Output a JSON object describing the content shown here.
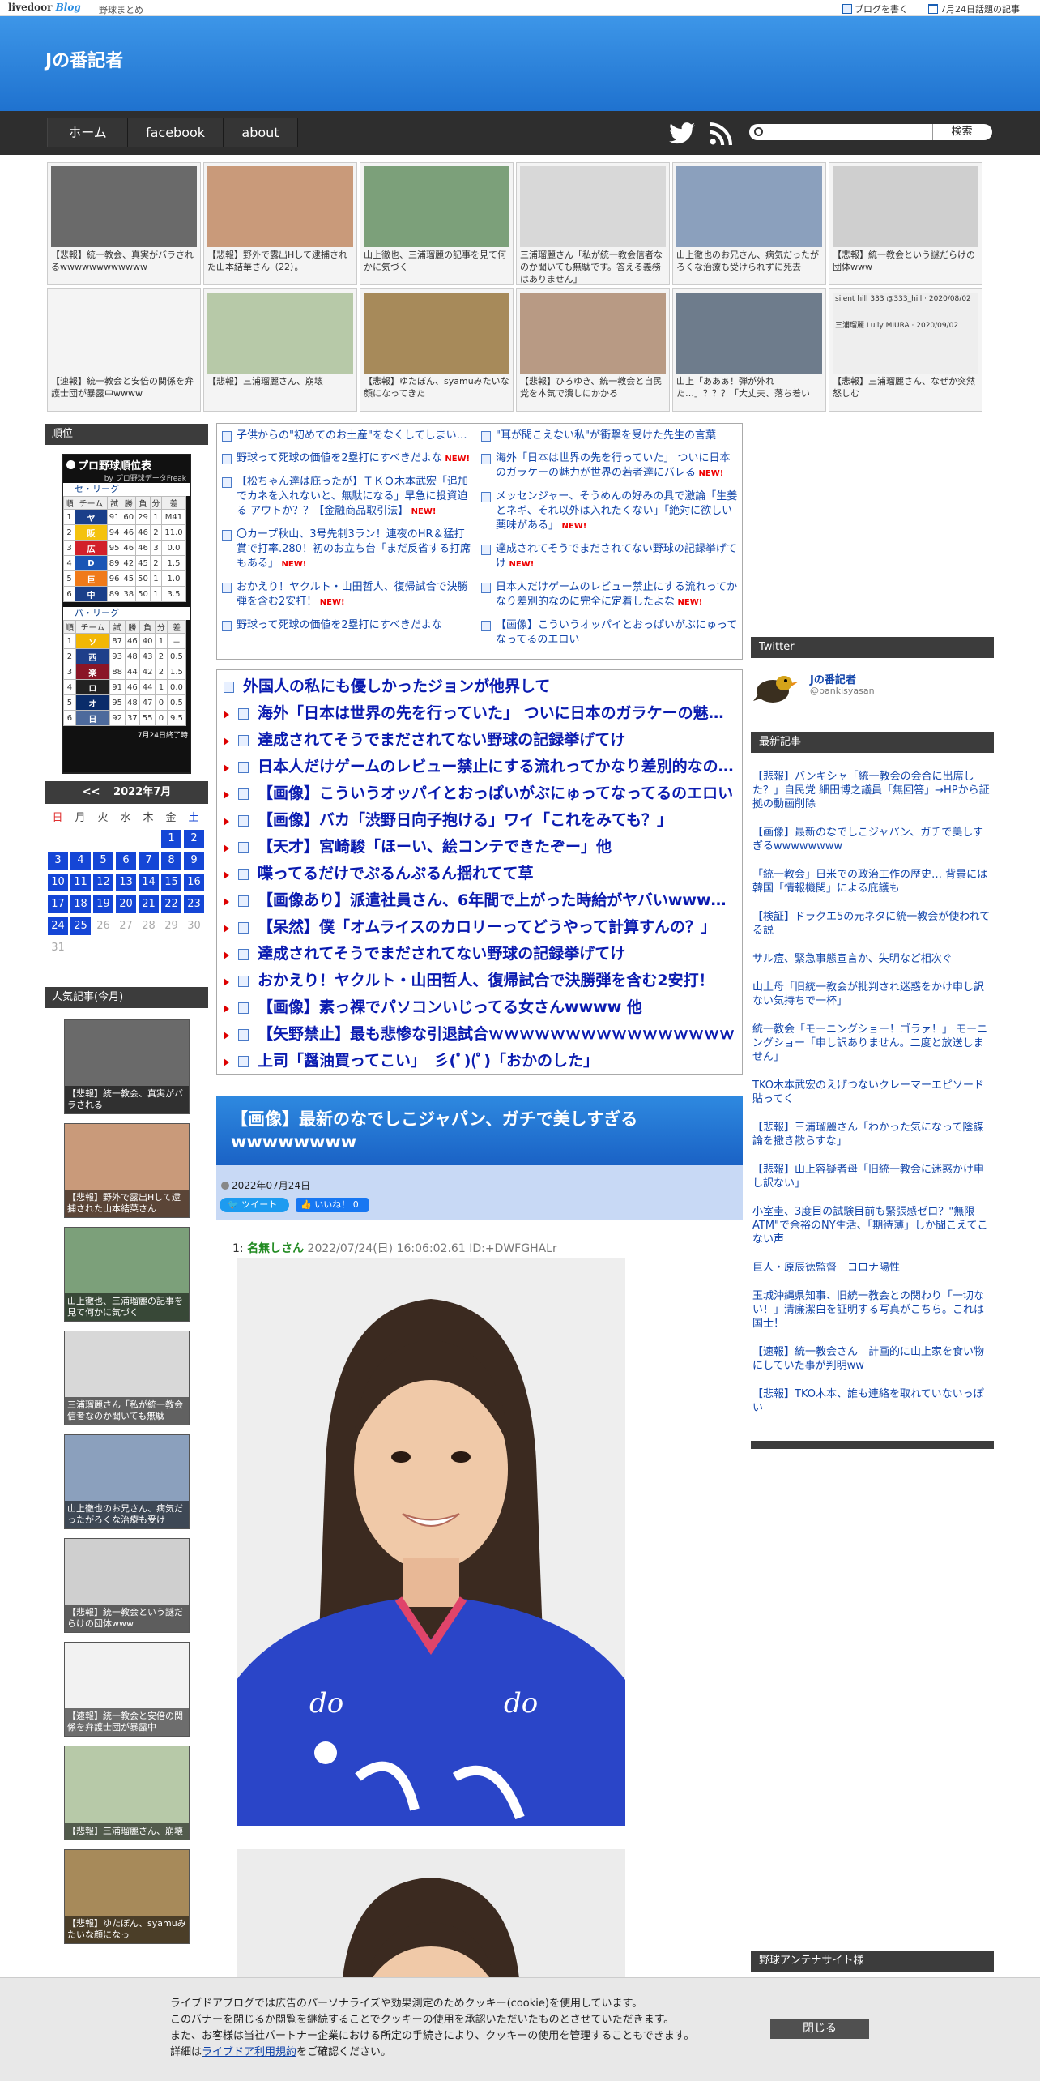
{
  "topbar": {
    "logo_main": "livedoor",
    "logo_sub": "Blog",
    "blog_name_small": "野球まとめ",
    "write_blog": "ブログを書く",
    "trending": "7月24日話題の記事"
  },
  "header": {
    "title": "Jの番記者"
  },
  "nav": {
    "items": [
      "ホーム",
      "facebook",
      "about"
    ],
    "search_button": "検索"
  },
  "thumbs": [
    {
      "caption": "【悲報】統一教会、真実がバラされるwwwwwwwwwwww",
      "color": "#6a6a6a"
    },
    {
      "caption": "【悲報】野外で露出Hして逮捕された山本結華さん（22）。",
      "color": "#c99a7a"
    },
    {
      "caption": "山上徹也、三浦瑠麗の記事を見て何かに気づく",
      "color": "#7ca07a"
    },
    {
      "caption": "三浦瑠麗さん「私が統一教会信者なのか聞いても無駄です。答える義務はありません」",
      "color": "#d8d8d8"
    },
    {
      "caption": "山上徹也のお兄さん、病気だったがろくな治療も受けられずに死去",
      "color": "#8ba0bd"
    },
    {
      "caption": "【悲報】統一教会という謎だらけの団体www",
      "color": "#cfcfcf"
    },
    {
      "caption": "【速報】統一教会と安倍の関係を弁護士団が暴露中wwww",
      "color": "#f4f4f4"
    },
    {
      "caption": "【悲報】三浦瑠麗さん、崩壊",
      "color": "#b7c9a8"
    },
    {
      "caption": "【悲報】ゆたぼん、syamuみたいな顔になってきた",
      "color": "#a78a5a"
    },
    {
      "caption": "【悲報】ひろゆき、統一教会と自民党を本気で潰しにかかる",
      "color": "#b89a84"
    },
    {
      "caption": "山上「ああぁ！弾が外れた…」？？？「大丈夫、落ち着い",
      "color": "#6e7c8c"
    },
    {
      "caption": "【悲報】三浦瑠麗さん、なぜか突然怒しむ",
      "color": "#eeeeee"
    }
  ],
  "thumb_tweet": {
    "user": "silent hill 333",
    "handle": "@333_hill",
    "date": "2020/08/02",
    "name2": "三浦瑠麗 Lully MIURA",
    "date2": "2020/09/02"
  },
  "sidebar": {
    "ranking_header": "順位",
    "standings_title": "プロ野球順位表",
    "standings_sub": "by プロ野球データFreak",
    "central_label": "セ・リーグ",
    "pacific_label": "パ・リーグ",
    "cols": [
      "順",
      "チーム",
      "試",
      "勝",
      "負",
      "分",
      "差"
    ],
    "central": [
      [
        "1",
        "ヤ",
        "91",
        "60",
        "29",
        "1",
        "M41"
      ],
      [
        "2",
        "阪",
        "94",
        "46",
        "46",
        "2",
        "11.0"
      ],
      [
        "3",
        "広",
        "95",
        "46",
        "46",
        "3",
        "0.0"
      ],
      [
        "4",
        "D",
        "89",
        "42",
        "45",
        "2",
        "1.5"
      ],
      [
        "5",
        "巨",
        "96",
        "45",
        "50",
        "1",
        "1.0"
      ],
      [
        "6",
        "中",
        "89",
        "38",
        "50",
        "1",
        "3.5"
      ]
    ],
    "pacific": [
      [
        "1",
        "ソ",
        "87",
        "46",
        "40",
        "1",
        "－"
      ],
      [
        "2",
        "西",
        "93",
        "48",
        "43",
        "2",
        "0.5"
      ],
      [
        "3",
        "楽",
        "88",
        "44",
        "42",
        "2",
        "1.5"
      ],
      [
        "4",
        "ロ",
        "91",
        "46",
        "44",
        "1",
        "0.0"
      ],
      [
        "5",
        "オ",
        "95",
        "48",
        "47",
        "0",
        "0.5"
      ],
      [
        "6",
        "日",
        "92",
        "37",
        "55",
        "0",
        "9.5"
      ]
    ],
    "standings_footer": "7月24日終了時",
    "cal_prev": "<<",
    "cal_title": "2022年7月",
    "dows": [
      "日",
      "月",
      "火",
      "水",
      "木",
      "金",
      "土"
    ],
    "popular_header": "人気記事(今月)",
    "popular": [
      {
        "caption": "【悲報】統一教会、真実がバラされる",
        "color": "#6a6a6a"
      },
      {
        "caption": "【悲報】野外で露出Hして逮捕された山本結菜さん",
        "color": "#c99a7a"
      },
      {
        "caption": "山上徹也、三浦瑠麗の記事を見て何かに気づく",
        "color": "#7ca07a"
      },
      {
        "caption": "三浦瑠麗さん「私が統一教会信者なのか聞いても無駄",
        "color": "#d8d8d8"
      },
      {
        "caption": "山上徹也のお兄さん、病気だったがろくな治療も受け",
        "color": "#8ba0bd"
      },
      {
        "caption": "【悲報】統一教会という謎だらけの団体www",
        "color": "#cfcfcf"
      },
      {
        "caption": "【速報】統一教会と安倍の関係を弁護士団が暴露中",
        "color": "#f2f2f2"
      },
      {
        "caption": "【悲報】三浦瑠麗さん、崩壊",
        "color": "#b7c9a8"
      },
      {
        "caption": "【悲報】ゆたぼん、syamuみたいな顔になっ",
        "color": "#a78a5a"
      }
    ]
  },
  "list_left": [
    {
      "text": "子供からの\"初めてのお土産\"をなくしてしまい…",
      "new": false
    },
    {
      "text": "野球って死球の価値を2塁打にすべきだよな",
      "new": true
    },
    {
      "text": "【松ちゃん達は庇ったが】ＴＫＯ木本武宏「追加でカネを入れないと、無駄になる」早急に投資迫る アウトか？？【金融商品取引法】",
      "new": true
    },
    {
      "text": "〇カープ秋山、3号先制3ラン！連夜のHR＆猛打賞で打率.280！初のお立ち台「まだ反省する打席もある」",
      "new": true
    },
    {
      "text": "おかえり！ヤクルト・山田哲人、復帰試合で決勝弾を含む2安打！",
      "new": true
    },
    {
      "text": "野球って死球の価値を2塁打にすべきだよな",
      "new": false
    }
  ],
  "list_right": [
    {
      "text": "\"耳が聞こえない私\"が衝撃を受けた先生の言葉",
      "new": false
    },
    {
      "text": "海外「日本は世界の先を行っていた」 ついに日本のガラケーの魅力が世界の若者達にバレる",
      "new": true
    },
    {
      "text": "メッセンジャー、そうめんの好みの具で激論「生姜とネギ、それ以外は入れたくない」「絶対に欲しい薬味がある」",
      "new": true
    },
    {
      "text": "達成されてそうでまだされてない野球の記録挙げてけ",
      "new": true
    },
    {
      "text": "日本人だけゲームのレビュー禁止にする流れってかなり差別的なのに完全に定着したよな",
      "new": true
    },
    {
      "text": "【画像】こういうオッパイとおっぱいがぶにゅってなってるのエロい",
      "new": false
    }
  ],
  "big_list": [
    "外国人の私にも優しかったジョンが他界して",
    "海外「日本は世界の先を行っていた」 ついに日本のガラケーの魅力が世界の若者達にバレる",
    "達成されてそうでまだされてない野球の記録挙げてけ",
    "日本人だけゲームのレビュー禁止にする流れってかなり差別的なのに完全に定着したよな",
    "【画像】こういうオッパイとおっぱいがぶにゅってなってるのエロい",
    "【画像】バカ「渋野日向子抱ける」ワイ「これをみても？」",
    "【天才】宮崎駿「ほーい、絵コンテできたぞー」他",
    "喋ってるだけでぷるんぷるん揺れてて草",
    "【画像あり】派遣社員さん、6年間で上がった時給がヤバいwwwwwwwww",
    "【呆然】僕「オムライスのカロリーってどうやって計算すんの？」",
    "達成されてそうでまだされてない野球の記録挙げてけ",
    "おかえり！ヤクルト・山田哲人、復帰試合で決勝弾を含む2安打！",
    "【画像】素っ裸でパソコンいじってる女さんwwww 他",
    "【矢野禁止】最も悲惨な引退試合ｗｗｗｗｗｗｗｗｗｗｗｗｗｗｗｗ",
    "上司「醤油買ってこい」　彡(ﾟ)(ﾟ)「おかのした」"
  ],
  "article": {
    "title": "【画像】最新のなでしこジャパン、ガチで美しすぎるwwwwwwww",
    "date": "2022年07月24日",
    "tweet_label": "ツイート",
    "like_label": "いいね！",
    "like_count": "0",
    "post_num": "1:",
    "post_name": "名無しさん",
    "post_meta": "2022/07/24(日) 16:06:02.61 ID:+DWFGHALr"
  },
  "right": {
    "twitter_header": "Twitter",
    "twitter_name": "Jの番記者",
    "twitter_handle": "@bankisyasan",
    "recent_header": "最新記事",
    "recent": [
      "【悲報】バンキシャ「統一教会の会合に出席した？」自民党 細田博之議員「無回答」→HPから証拠の動画削除",
      "【画像】最新のなでしこジャパン、ガチで美しすぎるwwwwwwww",
      "「統一教会」日米での政治工作の歴史… 背景には韓国「情報機関」による庇護も",
      "【検証】ドラクエ5の元ネタに統一教会が使われてる説",
      "サル痘、緊急事態宣言か、失明など相次ぐ",
      "山上母「旧統一教会が批判され迷惑をかけ申し訳ない気持ちで一杯」",
      "統一教会「モーニングショー！ゴラァ！」 モーニングショー「申し訳ありません。二度と放送しません」",
      "TKO木本武宏のえげつないクレーマーエピソード貼ってく",
      "【悲報】三浦瑠麗さん「わかった気になって陰謀論を撒き散らすな」",
      "【悲報】山上容疑者母「旧統一教会に迷惑かけ申し訳ない」",
      "小室圭、3度目の試験目前も緊張感ゼロ？\"無限ATM\"で余裕のNY生活、「期待薄」しか聞こえてこない声",
      "巨人・原辰徳監督　コロナ陽性",
      "玉城沖縄県知事、旧統一教会との関わり「一切ない！」清廉潔白を証明する写真がこちら。これは国士！",
      "【速報】統一教会さん　計画的に山上家を食い物にしていた事が判明ww",
      "【悲報】TKO木本、誰も連絡を取れていないっぽい"
    ],
    "antenna_header": "野球アンテナサイト様"
  },
  "cookie": {
    "lines": [
      "ライブドアブログでは広告のパーソナライズや効果測定のためクッキー(cookie)を使用しています。",
      "このバナーを閉じるか閲覧を継続することでクッキーの使用を承認いただいたものとさせていただきます。",
      "また、お客様は当社パートナー企業における所定の手続きにより、クッキーの使用を管理することもできます。"
    ],
    "detail_pre": "詳細は",
    "detail_link": "ライブドア利用規約",
    "detail_post": "をご確認ください。",
    "close": "閉じる"
  }
}
